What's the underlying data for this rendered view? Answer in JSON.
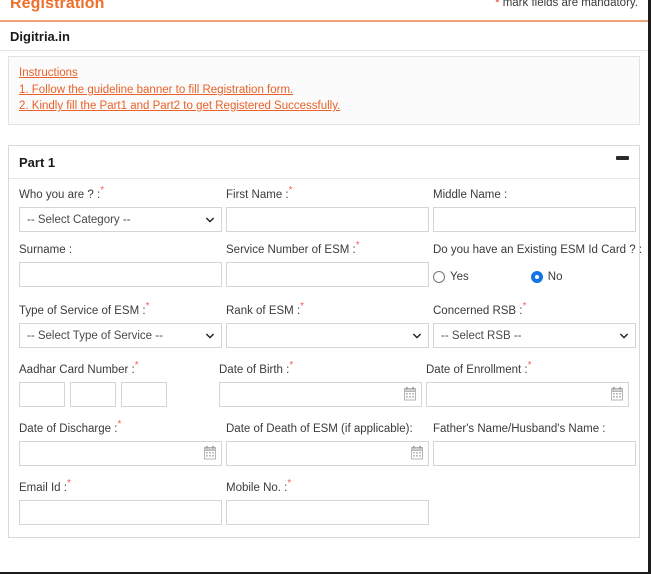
{
  "header": {
    "title": "Registration",
    "mandatory_note": "mark fields are mandatory.",
    "star": "*"
  },
  "site": {
    "name": "Digitria.in"
  },
  "instructions": {
    "heading": "Instructions",
    "lines": [
      "1. Follow the guideline banner to fill Registration form.",
      "2. Kindly fill the Part1 and Part2 to get Registered Successfully."
    ]
  },
  "part1": {
    "title": "Part 1",
    "collapse_label": "−",
    "fields": {
      "who_you_are": {
        "label": "Who you are ? :",
        "required": "*",
        "value": "-- Select Category --"
      },
      "first_name": {
        "label": "First Name :",
        "required": "*",
        "value": "",
        "placeholder": ""
      },
      "middle_name": {
        "label": "Middle Name :",
        "required": "",
        "value": "",
        "placeholder": ""
      },
      "surname": {
        "label": "Surname :",
        "required": "",
        "value": "",
        "placeholder": ""
      },
      "service_number": {
        "label": "Service Number of ESM :",
        "required": "*",
        "value": "",
        "placeholder": ""
      },
      "existing_esm_card": {
        "label": "Do you have an Existing ESM Id Card ? :",
        "required": "",
        "options": [
          {
            "label": "Yes",
            "selected": false
          },
          {
            "label": "No",
            "selected": true
          }
        ]
      },
      "type_of_service": {
        "label": "Type of Service of ESM :",
        "required": "*",
        "value": "-- Select Type of Service --"
      },
      "rank_of_esm": {
        "label": "Rank of ESM :",
        "required": "*",
        "value": ""
      },
      "concerned_rsb": {
        "label": "Concerned RSB :",
        "required": "*",
        "value": "-- Select RSB --"
      },
      "aadhar": {
        "label": "Aadhar Card Number :",
        "required": "*",
        "parts": [
          "",
          "",
          ""
        ]
      },
      "date_of_birth": {
        "label": "Date of Birth :",
        "required": "*",
        "value": "",
        "icon": "calendar-icon"
      },
      "date_of_enrollment": {
        "label": "Date of Enrollment :",
        "required": "*",
        "value": "",
        "icon": "calendar-icon"
      },
      "date_of_discharge": {
        "label": "Date of Discharge :",
        "required": "*",
        "value": "",
        "icon": "calendar-icon"
      },
      "date_of_death": {
        "label": "Date of Death of ESM (if applicable):",
        "required": "",
        "value": "",
        "icon": "calendar-icon"
      },
      "father_husband_name": {
        "label": "Father's Name/Husband's Name :",
        "required": "",
        "value": "",
        "placeholder": ""
      },
      "email_id": {
        "label": "Email Id :",
        "required": "*",
        "value": "",
        "placeholder": ""
      },
      "mobile_no": {
        "label": "Mobile No. :",
        "required": "*",
        "value": "",
        "placeholder": ""
      }
    }
  },
  "colors": {
    "accent_orange": "#ef6f2b",
    "instruction_orange": "#e8622a",
    "required_red": "#f0625f",
    "radio_blue": "#1473e6",
    "border_grey": "#d5d5d5"
  }
}
